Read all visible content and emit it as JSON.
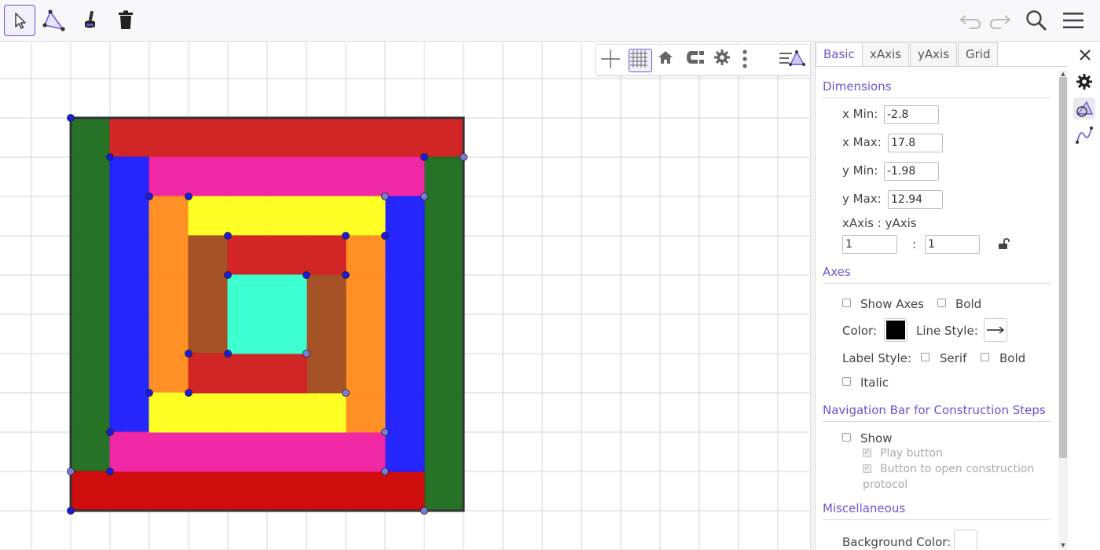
{
  "toolbar": {
    "tools": [
      "move-tool",
      "polygon-tool",
      "style-brush-tool",
      "delete-tool"
    ],
    "right_tools": [
      "undo",
      "redo",
      "search",
      "menu"
    ]
  },
  "style_bar": {
    "buttons": [
      "show-axes",
      "show-grid",
      "standard-view",
      "point-capturing",
      "graphics-settings",
      "more-options",
      "toggle-style-bar"
    ],
    "active": "show-grid"
  },
  "colors": {
    "accent": "#6557d2",
    "grid": "#d6d6d6",
    "green": "#1a6a1a",
    "red": "#d01a1a",
    "bottom_red": "#cc0000",
    "blue": "#1a1aff",
    "pink": "#f01ca0",
    "orange": "#ff8a1a",
    "yellow": "#ffff1a",
    "brown": "#a04a1a",
    "cyan": "#33ffcc",
    "point_dark": "#1a1ae0",
    "point_light": "#7a7ad8"
  },
  "settings": {
    "tabs": [
      "Basic",
      "xAxis",
      "yAxis",
      "Grid"
    ],
    "active_tab": "Basic",
    "dimensions": {
      "title": "Dimensions",
      "x_min_label": "x Min:",
      "x_min": "-2.8",
      "x_max_label": "x Max:",
      "x_max": "17.8",
      "y_min_label": "y Min:",
      "y_min": "-1.98",
      "y_max_label": "y Max:",
      "y_max": "12.94",
      "ratio_label": "xAxis : yAxis",
      "ratio_x": "1",
      "ratio_sep": ":",
      "ratio_y": "1"
    },
    "axes": {
      "title": "Axes",
      "show_axes": "Show Axes",
      "bold": "Bold",
      "color_label": "Color:",
      "line_style_label": "Line Style:",
      "label_style_label": "Label Style:",
      "serif": "Serif",
      "bold2": "Bold",
      "italic": "Italic"
    },
    "navigation": {
      "title": "Navigation Bar for Construction Steps",
      "show": "Show",
      "play_button": "Play button",
      "protocol_line1": "Button to open construction",
      "protocol_line2": "protocol"
    },
    "misc": {
      "title": "Miscellaneous",
      "background_color": "Background Color:"
    }
  }
}
